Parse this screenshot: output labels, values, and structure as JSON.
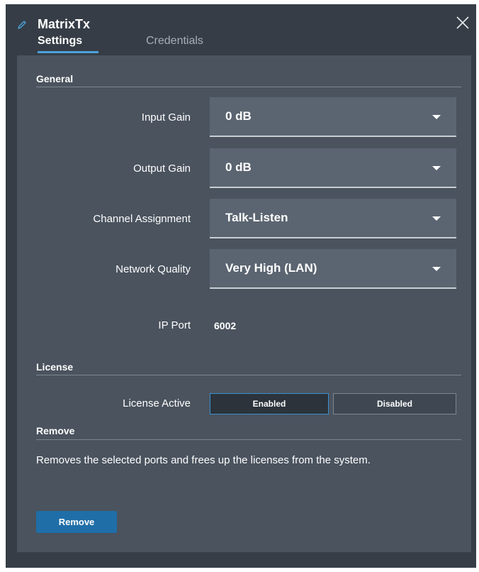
{
  "header": {
    "title": "MatrixTx",
    "tabs": [
      {
        "label": "Settings",
        "active": true
      },
      {
        "label": "Credentials",
        "active": false
      }
    ]
  },
  "general": {
    "section_title": "General",
    "input_gain": {
      "label": "Input Gain",
      "value": "0 dB"
    },
    "output_gain": {
      "label": "Output Gain",
      "value": "0 dB"
    },
    "channel_assignment": {
      "label": "Channel Assignment",
      "value": "Talk-Listen"
    },
    "network_quality": {
      "label": "Network Quality",
      "value": "Very High (LAN)"
    },
    "ip_port": {
      "label": "IP Port",
      "value": "6002"
    }
  },
  "license": {
    "section_title": "License",
    "active_label": "License Active",
    "options": [
      "Enabled",
      "Disabled"
    ],
    "selected": "Enabled"
  },
  "remove": {
    "section_title": "Remove",
    "description": "Removes the selected ports and frees up the licenses from the system.",
    "button_label": "Remove"
  },
  "colors": {
    "panel_bg": "#363d46",
    "content_bg": "#4a535e",
    "dropdown_bg": "#5b6571",
    "accent": "#4aa3d8",
    "button_blue": "#1f6ea8"
  },
  "icons": {
    "edit": "pencil-icon",
    "close": "close-icon",
    "dropdown": "caret-down-icon"
  }
}
